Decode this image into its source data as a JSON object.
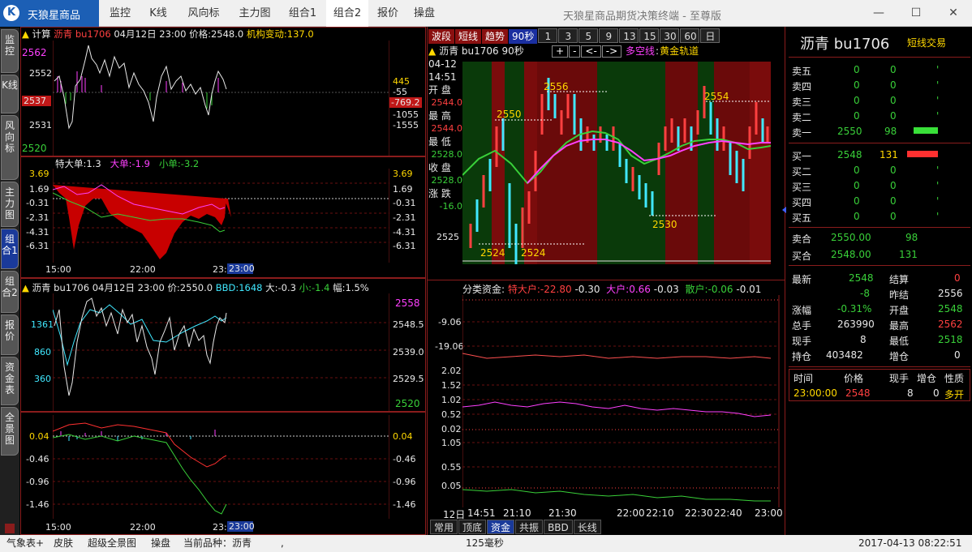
{
  "app": {
    "logo_text": "天狼星商品",
    "window_title": "天狼星商品期货决策终端 - 至尊版",
    "nav": [
      "监控",
      "K线",
      "风向标",
      "主力图",
      "组合1",
      "组合2",
      "报价",
      "操盘"
    ]
  },
  "side_tabs": [
    "监控",
    "K线",
    "风向标",
    "主力图",
    "组合1",
    "组合2",
    "报价",
    "资金表",
    "全景图"
  ],
  "panel1": {
    "h": [
      "▲",
      "计算",
      "沥青",
      "bu1706",
      "04月12日",
      "23:00",
      "价格:2548.0",
      "机构变动:137.0"
    ],
    "left_ticks": [
      "2562",
      "2552",
      "2537",
      "2531",
      "2520"
    ],
    "right_ticks": [
      "445",
      "-55",
      "-769.2",
      "-1055",
      "-1555"
    ]
  },
  "panel2": {
    "h": [
      "特大单:1.3",
      "大单:-1.9",
      "小单:-3.2"
    ],
    "ticks": [
      "3.69",
      "1.69",
      "-0.31",
      "-2.31",
      "-4.31",
      "-6.31"
    ],
    "times": [
      "15:00",
      "22:00",
      "23:",
      "23:00"
    ]
  },
  "panel3": {
    "h": [
      "▲",
      "沥青",
      "bu1706",
      "04月12日",
      "23:00",
      "价:2550.0",
      "BBD:1648",
      "大:-0.3",
      "小:-1.4",
      "幅:1.5%"
    ],
    "left_ticks": [
      "1361",
      "860",
      "360"
    ],
    "right_ticks": [
      "2558",
      "2548.5",
      "2539.0",
      "2529.5",
      "2520"
    ]
  },
  "panel4": {
    "ticks": [
      "0.04",
      "-0.46",
      "-0.96",
      "-1.46"
    ],
    "times": [
      "15:00",
      "22:00",
      "23:",
      "23:00"
    ]
  },
  "mid": {
    "buttons": [
      "波段",
      "短线",
      "趋势",
      "90秒",
      "1",
      "3",
      "5",
      "9",
      "13",
      "15",
      "30",
      "60",
      "日"
    ],
    "sub": [
      "+",
      "-",
      "<-",
      "->"
    ],
    "title": [
      "▲",
      "沥青",
      "bu1706",
      "90秒",
      "多空线",
      "黄金轨道"
    ],
    "info": [
      "04-12",
      "14:51",
      "开 盘",
      "2544.0",
      "最 高",
      "2544.0",
      "最 低",
      "2528.0",
      "收 盘",
      "2528.0",
      "涨 跌",
      "-16.0"
    ],
    "axis_price": "2525",
    "annotations": [
      "2556",
      "2550",
      "2554",
      "2530",
      "2524",
      "2524"
    ],
    "flow_title": [
      "分类资金:",
      "特大户:",
      "-22.80",
      "-0.30",
      "大户:",
      "0.66",
      "-0.03",
      "散户:",
      "-0.06",
      "-0.01"
    ],
    "flow_ticks": [
      "-9.06",
      "-19.06",
      "2.02",
      "1.52",
      "1.02",
      "0.52",
      "0.02",
      "1.05",
      "0.55",
      "0.05"
    ],
    "times": [
      "12日",
      "14:51",
      "21:10",
      "21:30",
      "22:00",
      "22:10",
      "22:30",
      "22:40",
      "23:00"
    ],
    "tabs": [
      "常用",
      "顶底",
      "资金",
      "共振",
      "BBD",
      "长线"
    ]
  },
  "right": {
    "name": "沥青",
    "code": "bu1706",
    "mode": "短线交易",
    "sells": [
      [
        "卖五",
        "0",
        "0"
      ],
      [
        "卖四",
        "0",
        "0"
      ],
      [
        "卖三",
        "0",
        "0"
      ],
      [
        "卖二",
        "0",
        "0"
      ],
      [
        "卖一",
        "2550",
        "98"
      ]
    ],
    "buys": [
      [
        "买一",
        "2548",
        "131"
      ],
      [
        "买二",
        "0",
        "0"
      ],
      [
        "买三",
        "0",
        "0"
      ],
      [
        "买四",
        "0",
        "0"
      ],
      [
        "买五",
        "0",
        "0"
      ]
    ],
    "sell_price": [
      "卖合",
      "2550.00",
      "98"
    ],
    "buy_price": [
      "买合",
      "2548.00",
      "131"
    ],
    "stats": [
      [
        "最新",
        "2548",
        "结算",
        "0"
      ],
      [
        "",
        "-8",
        "昨结",
        "2556"
      ],
      [
        "涨幅",
        "-0.31%",
        "开盘",
        "2548"
      ],
      [
        "总手",
        "263990",
        "最高",
        "2562"
      ],
      [
        "现手",
        "8",
        "最低",
        "2518"
      ],
      [
        "持仓",
        "403482",
        "增仓",
        "0"
      ]
    ],
    "tick_header": [
      "时间",
      "价格",
      "现手",
      "增仓",
      "性质"
    ],
    "tick_row": [
      "23:00:00",
      "2548",
      "8",
      "0",
      "多开"
    ]
  },
  "status": {
    "items": [
      "气象表+",
      "皮肤",
      "超级全景图",
      "操盘",
      "当前品种：沥青",
      ","
    ],
    "latency": "125毫秒",
    "datetime": "2017-04-13 08:22:51"
  }
}
